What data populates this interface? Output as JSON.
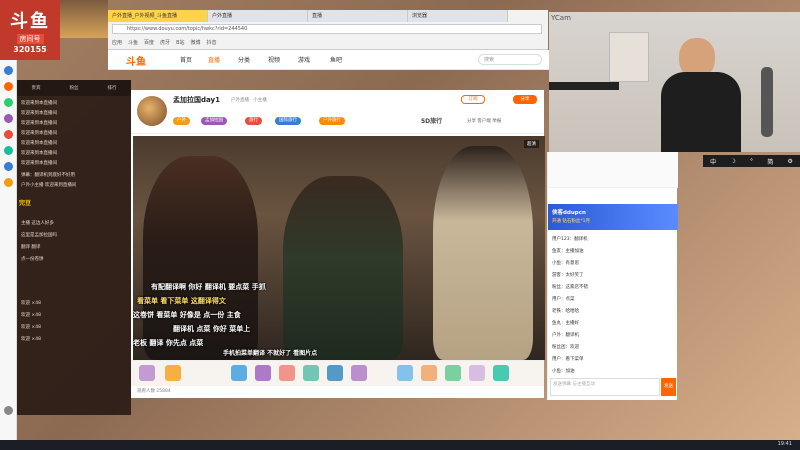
{
  "broadcast": {
    "logo": "斗鱼",
    "room_label": "房间号",
    "room_number": "320155"
  },
  "browser": {
    "tabs": [
      "户外直播_户外视频_斗鱼直播",
      "户外直播",
      "直播",
      "浏览器"
    ],
    "url": "https://www.douyu.com/topic/hwkc?rid=244540",
    "bookmarks": [
      "应用",
      "斗鱼",
      "百度",
      "虎牙",
      "B站",
      "微博",
      "抖音"
    ]
  },
  "site": {
    "logo": "斗鱼",
    "nav": [
      "首页",
      "直播",
      "分类",
      "视频",
      "游戏",
      "鱼吧"
    ],
    "search_placeholder": "搜索"
  },
  "room": {
    "title": "孟加拉国day1",
    "meta": "户外直播 · 小主播",
    "badges": [
      "户外",
      "孟加拉国",
      "旅行",
      "国际旅行",
      "户外旅行"
    ],
    "logo5d": "5D旅行",
    "actions": "分享  客户端  举报",
    "subscribe": "订阅",
    "share": "分享",
    "video_badge": "超清",
    "footer": "观看人数 25884"
  },
  "subtitles": [
    "有配翻译啊  你好  翻译机  要点菜  手抓",
    "看菜单  看下菜单  这翻译得文",
    "这卷饼  看菜单 好像是  点一份  主食",
    "翻译机  点菜  你好  菜单上",
    "老板  翻译  你先点  点菜",
    "手机拍菜单翻译  不就好了  看图片点"
  ],
  "danmu": {
    "tabs": [
      "贵宾",
      "粉丝",
      "排行"
    ],
    "rows": [
      "欢迎来到本直播间",
      "欢迎来到本直播间",
      "欢迎来到本直播间",
      "欢迎来到本直播间",
      "欢迎来到本直播间",
      "欢迎来到本直播间",
      "欢迎来到本直播间",
      "弹幕：翻译机到底好不好用",
      "户外小主播 欢迎来到直播间",
      "主播 这边人好多",
      "这里是孟加拉国吗",
      "翻译 翻译",
      "点一份卷饼",
      "欢迎 ×48",
      "欢迎 ×48",
      "欢迎 ×48",
      "欢迎 ×48"
    ],
    "highlight": "完豆"
  },
  "chat": {
    "promo_title": "侠客ddupcn",
    "promo_sub": "开通  钻石粉丝*1月",
    "rows": [
      "用户123：翻译机",
      "鱼友：主播加油",
      "小鱼：有意思",
      "游客：太好笑了",
      "粉丝：这家店不错",
      "用户：点菜",
      "老铁：哈哈哈",
      "鱼丸：主播好",
      "户外：翻译机",
      "粉丝团：欢迎",
      "用户：看下菜单",
      "小鱼：加油"
    ],
    "input_placeholder": "发送弹幕 与主播互动",
    "send": "发送"
  },
  "webcam": {
    "label": "YCam"
  },
  "ime": [
    "中",
    "☽",
    "°",
    "简",
    "⚙"
  ],
  "taskbar": {
    "clock": "19:41"
  },
  "colors": {
    "accent": "#ff6600",
    "brand_red": "#c0392b"
  }
}
